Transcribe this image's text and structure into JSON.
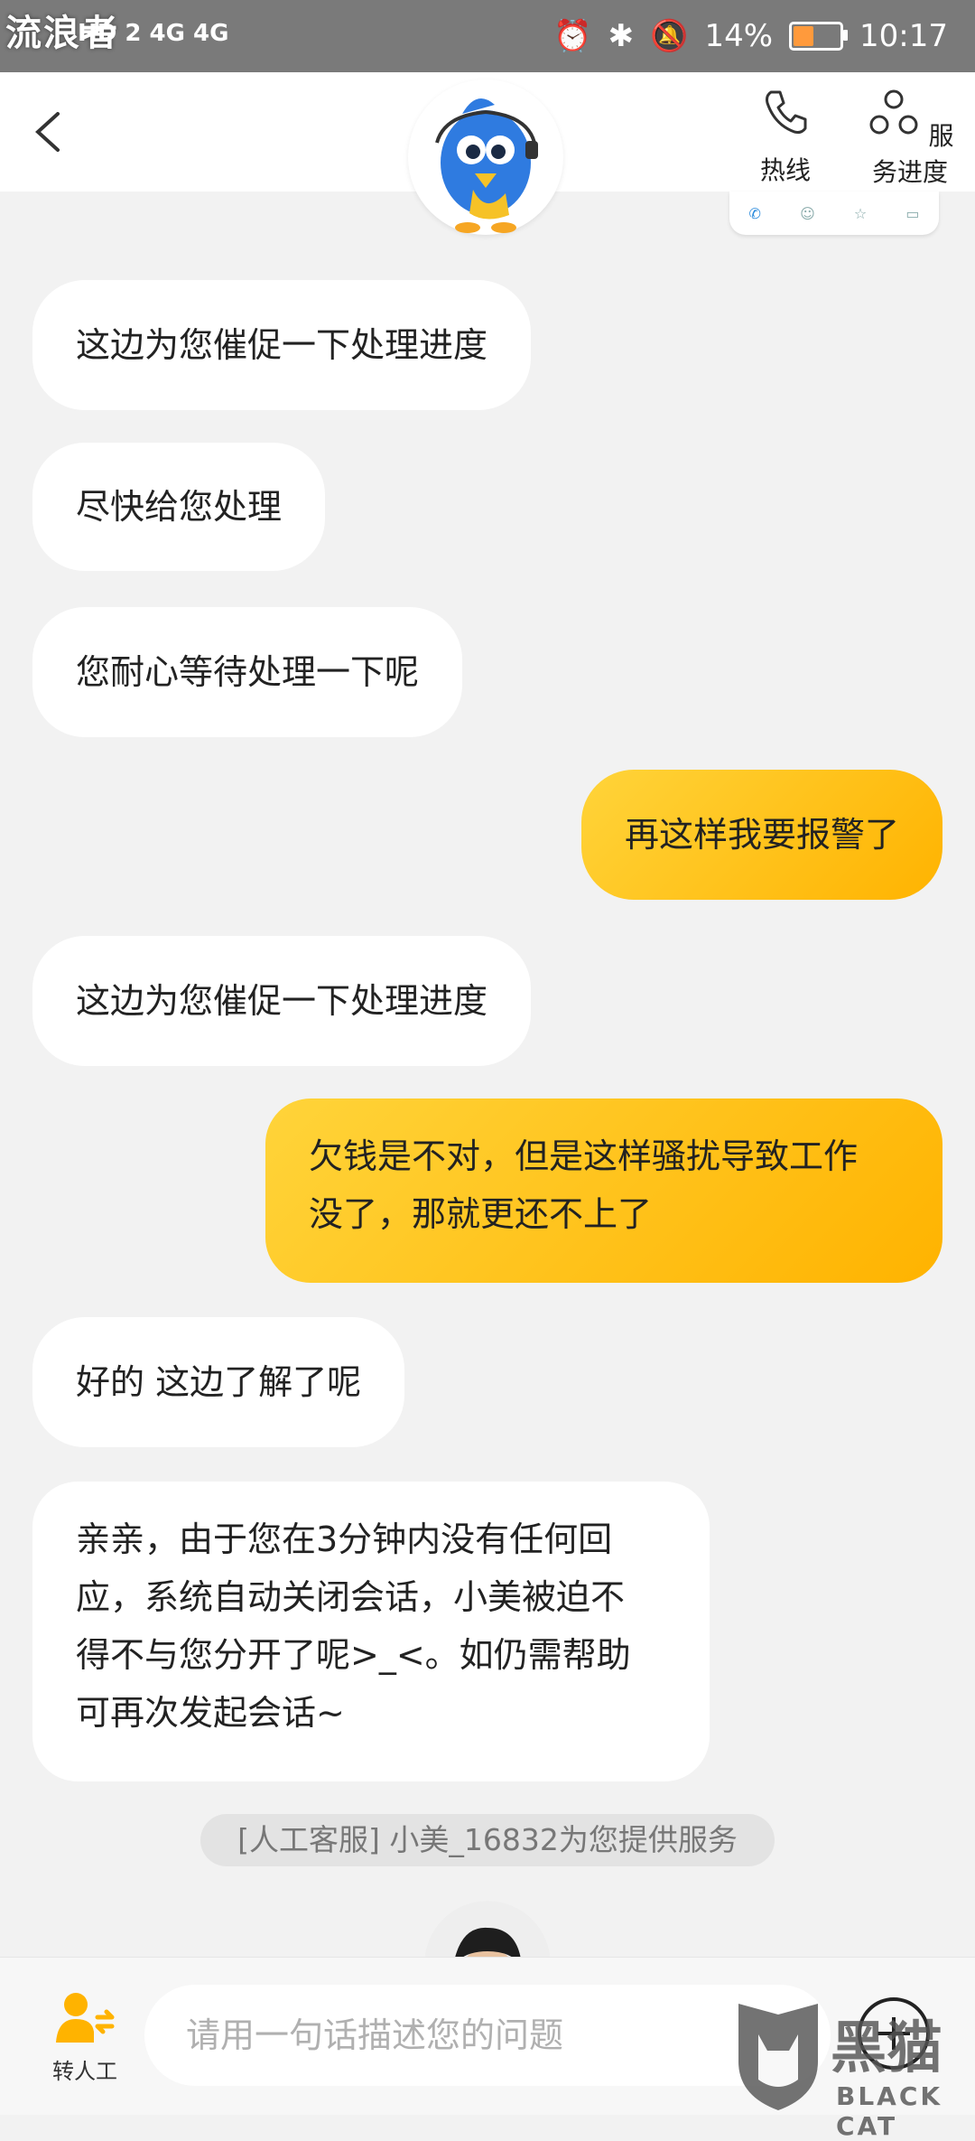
{
  "status_bar": {
    "watermark_text": "流浪者",
    "net_label": "HD 2 4G 4G",
    "battery": "14%",
    "time": "10:17"
  },
  "header": {
    "hotline_label": "热线",
    "progress_label": "服务进度"
  },
  "messages": [
    {
      "side": "in",
      "text": "这边为您催促一下处理进度"
    },
    {
      "side": "in",
      "text": "尽快给您处理"
    },
    {
      "side": "in",
      "text": "您耐心等待处理一下呢"
    },
    {
      "side": "out",
      "text": "再这样我要报警了"
    },
    {
      "side": "in",
      "text": "这边为您催促一下处理进度"
    },
    {
      "side": "out",
      "lines": [
        "欠钱是不对，但是这样骚扰导致工作",
        "没了，那就更还不上了"
      ]
    },
    {
      "side": "in",
      "text": "好的 这边了解了呢"
    },
    {
      "side": "in",
      "lines": [
        "亲亲，由于您在3分钟内没有任何回",
        "应，系统自动关闭会话，小美被迫不",
        "得不与您分开了呢>_<。如仍需帮助",
        "可再次发起会话~"
      ]
    }
  ],
  "system_notice": "[人工客服] 小美_16832为您提供服务",
  "bottom": {
    "transfer_label": "转人工",
    "input_placeholder": "请用一句话描述您的问题"
  },
  "watermark": {
    "title": "黑猫",
    "subtitle": "BLACK CAT"
  },
  "colors": {
    "accent_yellow": "#ffc107",
    "incoming_bubble": "#ffffff",
    "background": "#f2f2f2"
  }
}
